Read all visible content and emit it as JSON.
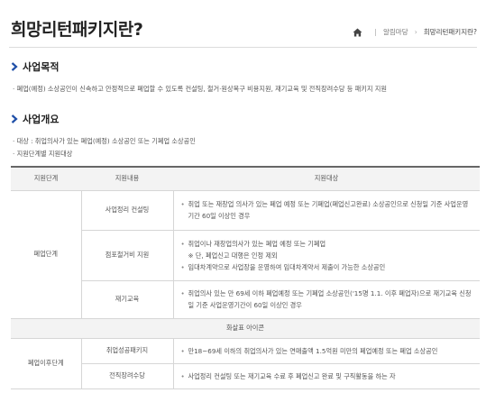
{
  "header": {
    "title": "희망리턴패키지란?",
    "breadcrumb": [
      "알림마당",
      "희망리턴패키지란?"
    ]
  },
  "sections": [
    {
      "heading": "사업목적",
      "bullets": [
        "폐업(예정) 소상공인이 신속하고 안정적으로 폐업할 수 있도록 컨설팅, 철거·원상복구 비용지원, 재기교육 및 전직장려수당 등 패키지 지원"
      ]
    },
    {
      "heading": "사업개요",
      "bullets": [
        "대상 : 취업의사가 있는 폐업(예정) 소상공인 또는 기폐업 소상공인",
        "지원단계별 지원대상"
      ]
    }
  ],
  "table": {
    "headers": [
      "지원단계",
      "지원내용",
      "지원대상"
    ],
    "stage1": "폐업단계",
    "stage2": "폐업이후단계",
    "rows": [
      {
        "content": "사업정리 컨설팅",
        "targets": [
          "취업 또는 재창업 의사가 있는 폐업 예정 또는 기폐업(폐업신고완료) 소상공인으로 신청일 기준 사업운영기간 60일 이상인 경우"
        ]
      },
      {
        "content": "점포철거비 지원",
        "targets": [
          "취업이나 재창업의사가 있는 폐업 예정 또는 기폐업",
          "※ 단, 폐업신고 대행은 인정 제외",
          "임대차계약으로 사업장을 운영하여 임대차계약서 제출이 가능한 소상공인"
        ]
      },
      {
        "content": "재기교육",
        "targets": [
          "취업의사 있는 만 69세 이하 폐업예정 또는 기폐업 소상공인('15명 1.1. 이후 폐업자)으로 재기교육 신청일 기준 사업운영기간이 60일 이상인 경우"
        ]
      },
      {
        "content": "취업성공패키지",
        "targets": [
          "만18~69세 이하의 취업의사가 있는 연매출액 1.5억원 미만의 폐업예정 또는 폐업 소상공인"
        ]
      },
      {
        "content": "전직장려수당",
        "targets": [
          "사업정리 컨설팅 또는 재기교육 수료 후 폐업신고 완료 및 구직활동을 하는 자"
        ]
      }
    ],
    "divider": "화살표 아이콘"
  }
}
